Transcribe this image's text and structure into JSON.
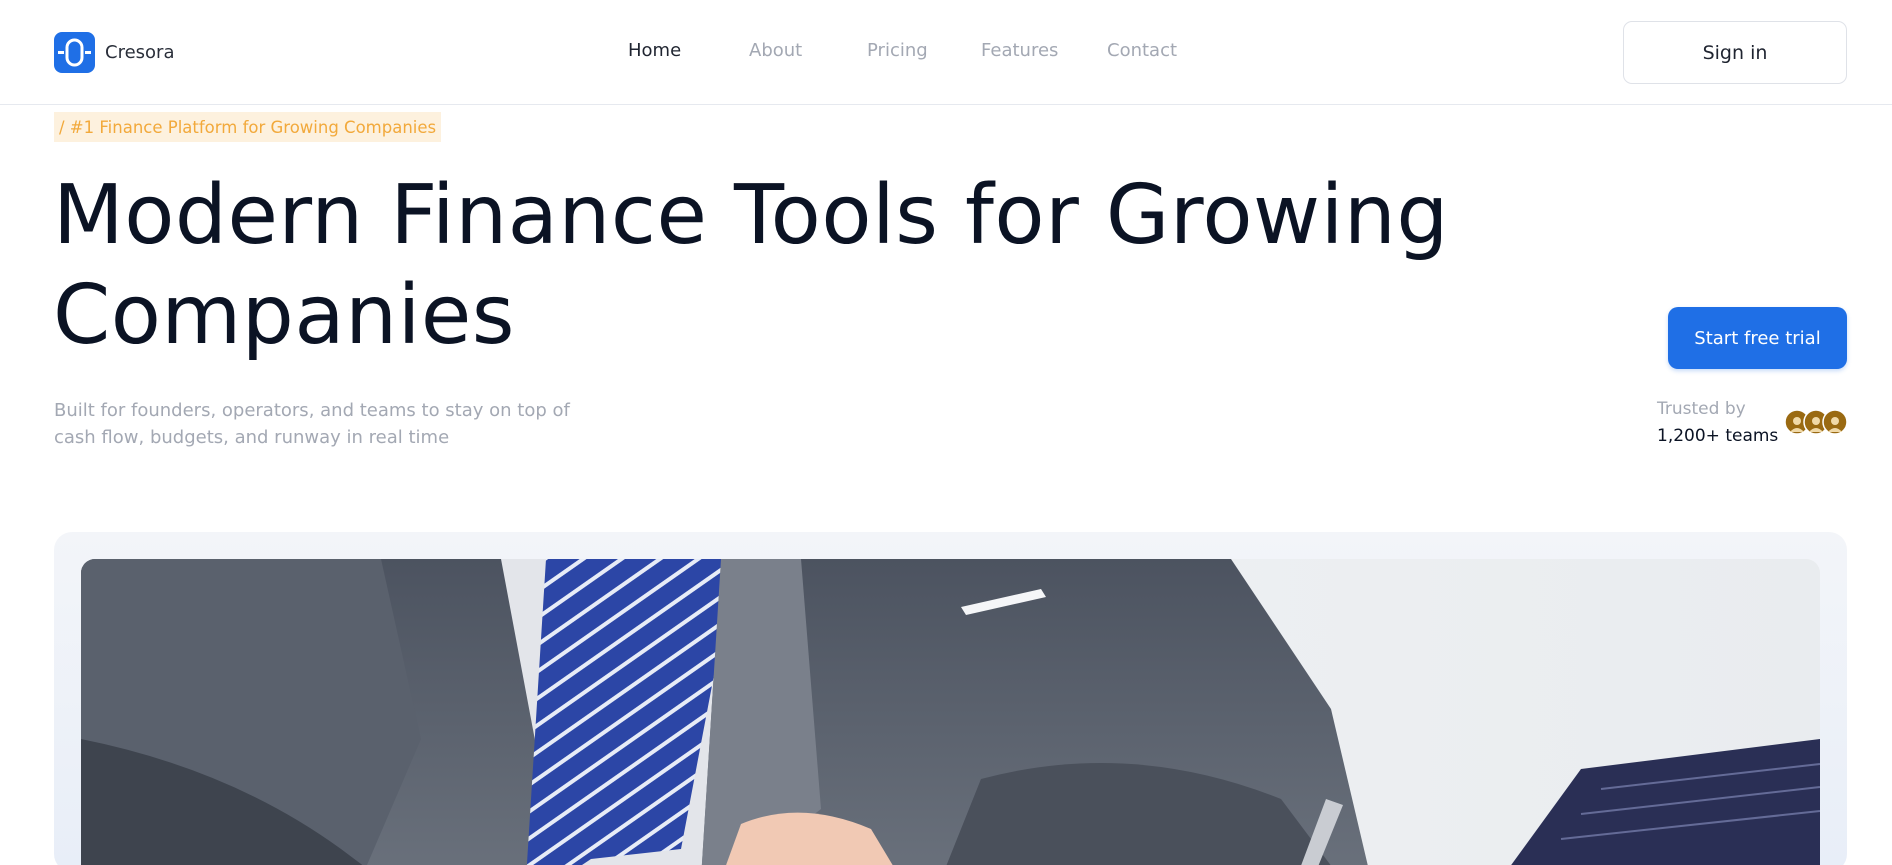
{
  "brand": {
    "name": "Cresora",
    "logo_icon": "cresora-logo-icon",
    "accent": "#1f6fe6"
  },
  "nav": {
    "items": [
      {
        "label": "Home",
        "active": true
      },
      {
        "label": "About",
        "active": false
      },
      {
        "label": "Pricing",
        "active": false
      },
      {
        "label": "Features",
        "active": false
      },
      {
        "label": "Contact",
        "active": false
      }
    ],
    "signin_label": "Sign in"
  },
  "hero": {
    "badge": "/ #1 Finance Platform for Growing Companies",
    "badge_color": "#f2a93b",
    "title_line1": "Modern Finance Tools for Growing",
    "title_line2": "Companies",
    "subtitle": "Built for founders, operators, and teams to stay on top of cash flow, budgets, and runway in real time",
    "cta_label": "Start free trial",
    "trusted_label": "Trusted by",
    "trusted_count": "1,200+ teams",
    "avatars_icon": "team-avatars-icon"
  },
  "hero_image": {
    "icon": "businessman-photo"
  }
}
